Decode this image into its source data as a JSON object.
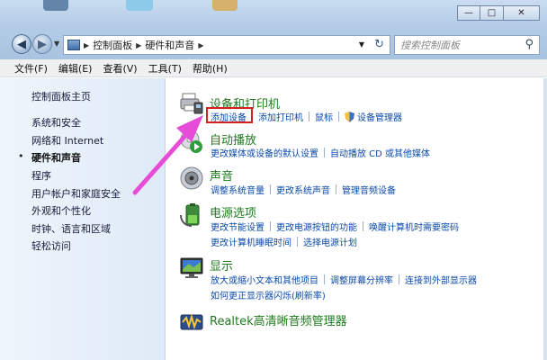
{
  "window": {
    "buttons": {
      "minimize": "—",
      "maximize": "□",
      "close": "✕"
    }
  },
  "address": {
    "crumbs": [
      "控制面板",
      "硬件和声音"
    ],
    "search_placeholder": "搜索控制面板"
  },
  "menu": [
    "文件(F)",
    "编辑(E)",
    "查看(V)",
    "工具(T)",
    "帮助(H)"
  ],
  "sidebar": {
    "items": [
      {
        "label": "控制面板主页"
      },
      {
        "label": "系统和安全"
      },
      {
        "label": "网络和 Internet"
      },
      {
        "label": "硬件和声音",
        "current": true
      },
      {
        "label": "程序"
      },
      {
        "label": "用户帐户和家庭安全"
      },
      {
        "label": "外观和个性化"
      },
      {
        "label": "时钟、语言和区域"
      },
      {
        "label": "轻松访问"
      }
    ]
  },
  "categories": {
    "devices": {
      "title": "设备和打印机",
      "links": [
        "添加设备",
        "添加打印机",
        "鼠标",
        "设备管理器"
      ]
    },
    "autoplay": {
      "title": "自动播放",
      "links": [
        "更改媒体或设备的默认设置",
        "自动播放 CD 或其他媒体"
      ]
    },
    "sound": {
      "title": "声音",
      "links": [
        "调整系统音量",
        "更改系统声音",
        "管理音频设备"
      ]
    },
    "power": {
      "title": "电源选项",
      "links1": [
        "更改节能设置",
        "更改电源按钮的功能",
        "唤醒计算机时需要密码"
      ],
      "links2": [
        "更改计算机睡眠时间",
        "选择电源计划"
      ]
    },
    "display": {
      "title": "显示",
      "links1": [
        "放大或缩小文本和其他项目",
        "调整屏幕分辨率",
        "连接到外部显示器"
      ],
      "links2": [
        "如何更正显示器闪烁(刷新率)"
      ]
    },
    "realtek": {
      "title": "Realtek高清晰音频管理器"
    }
  },
  "colors": {
    "highlight_box": "#d62020",
    "arrow": "#e64cd8",
    "category_title": "#1f7a1f",
    "link": "#0b4aa8"
  }
}
